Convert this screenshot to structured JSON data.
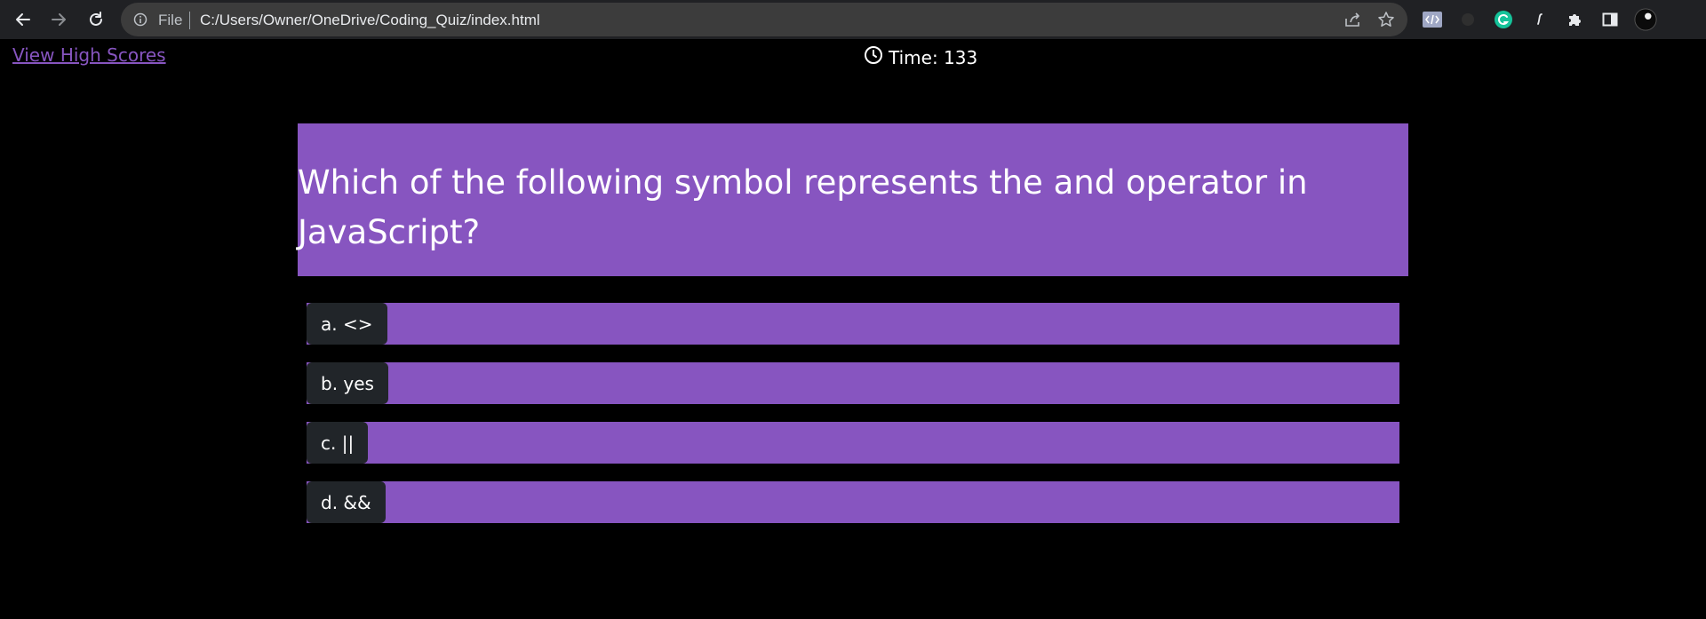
{
  "browser": {
    "scheme_label": "File",
    "url": "C:/Users/Owner/OneDrive/Coding_Quiz/index.html",
    "icons": [
      "back-icon",
      "forward-icon",
      "reload-icon",
      "info-icon",
      "share-icon",
      "star-icon",
      "code-extension-icon",
      "extension-icon",
      "grammarly-icon",
      "script-extension-icon",
      "puzzle-icon",
      "side-panel-icon",
      "profile-avatar"
    ],
    "colors": {
      "chrome": "#202124",
      "omnibox": "#3c3c3c",
      "grammarly": "#15c39a"
    }
  },
  "page": {
    "high_scores_link": "View High Scores",
    "timer_label": "Time: 133",
    "question": "Which of the following symbol represents the and operator in JavaScript?",
    "answers": [
      {
        "label": "a. <>"
      },
      {
        "label": "b. yes"
      },
      {
        "label": "c. ||"
      },
      {
        "label": "d. &&"
      }
    ],
    "colors": {
      "accent": "#8755c0",
      "button": "#212529",
      "background": "#000000"
    }
  }
}
